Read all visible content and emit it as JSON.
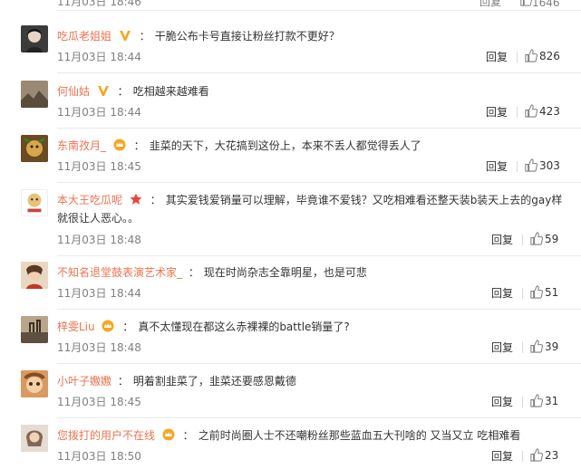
{
  "top_partial": {
    "time": "11月03日 18:46",
    "reply_label": "回复",
    "likes": "1646"
  },
  "comments": [
    {
      "user": "吃瓜老姐姐",
      "badge": "v-yellow",
      "text": "干脆公布卡号直接让粉丝打款不更好？",
      "time": "11月03日 18:44",
      "reply_label": "回复",
      "likes": "826",
      "avatar_color": "#3b3b3b"
    },
    {
      "user": "何仙姑",
      "badge": "v-yellow",
      "text": "吃相越来越难看",
      "time": "11月03日 18:44",
      "reply_label": "回复",
      "likes": "423",
      "avatar_color": "#7a6a55"
    },
    {
      "user": "东南孜月_",
      "badge": "crown",
      "text": "韭菜的天下，大花搞到这份上，本来不丢人都觉得丢人了",
      "time": "11月03日 18:45",
      "reply_label": "回复",
      "likes": "303",
      "avatar_color": "#8a5a2b"
    },
    {
      "user": "本大王吃瓜呢",
      "badge": "star",
      "text": "其实爱钱爱销量可以理解，毕竟谁不爱钱？又吃相难看还整天装b装天上去的gay样就很让人恶心。。",
      "time": "11月03日 18:48",
      "reply_label": "回复",
      "likes": "59",
      "avatar_color": "#d9b36a"
    },
    {
      "user": "不知名退堂鼓表演艺术家_",
      "badge": "",
      "text": "现在时尚杂志全靠明星，也是可悲",
      "time": "11月03日 18:44",
      "reply_label": "回复",
      "likes": "51",
      "avatar_color": "#c9a27a"
    },
    {
      "user": "梓雯Liu",
      "badge": "crown",
      "text": "真不太懂现在都这么赤裸裸的battle销量了?",
      "time": "11月03日 18:48",
      "reply_label": "回复",
      "likes": "39",
      "avatar_color": "#8d7a62"
    },
    {
      "user": "小叶子嫐嫐",
      "badge": "",
      "text": "明着割韭菜了，韭菜还要感恩戴德",
      "time": "11月03日 18:45",
      "reply_label": "回复",
      "likes": "31",
      "avatar_color": "#b8734a"
    },
    {
      "user": "您拨打的用户不在线",
      "badge": "crown",
      "text": "之前时尚圈人士不还嘲粉丝那些蓝血五大刊啥的 又当又立 吃相难看",
      "time": "11月03日 18:50",
      "reply_label": "回复",
      "likes": "23",
      "avatar_color": "#a48b77"
    }
  ]
}
